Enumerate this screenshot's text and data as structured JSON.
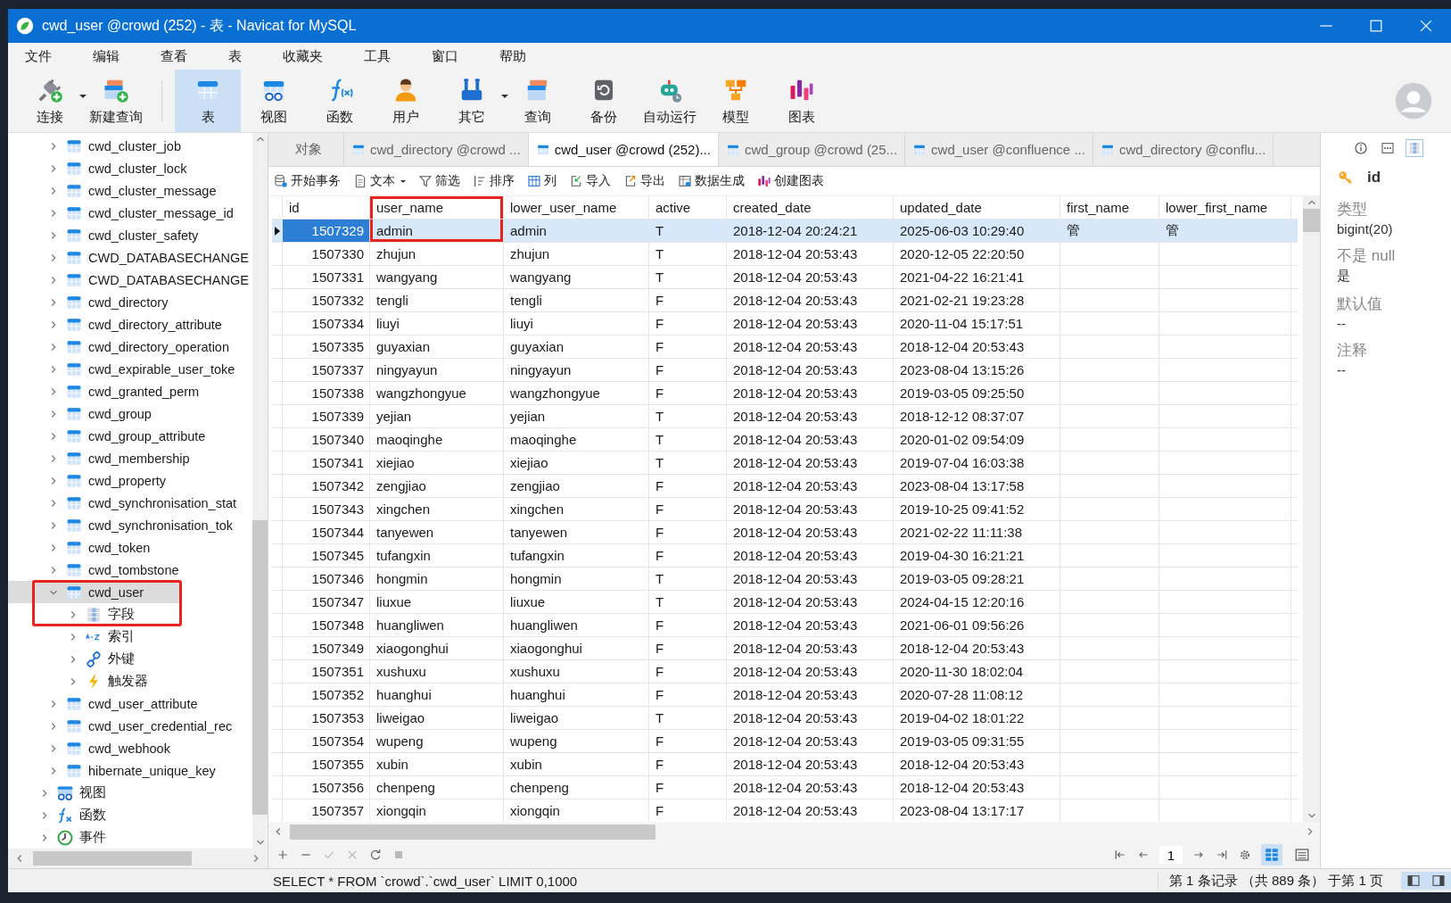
{
  "window": {
    "title": "cwd_user @crowd (252) - 表 - Navicat for MySQL"
  },
  "menu": [
    "文件",
    "编辑",
    "查看",
    "表",
    "收藏夹",
    "工具",
    "窗口",
    "帮助"
  ],
  "toolbar": [
    {
      "kind": "connect",
      "label": "连接",
      "dropdown": true,
      "selected": false
    },
    {
      "kind": "new-query",
      "label": "新建查询",
      "dropdown": false,
      "selected": false
    },
    {
      "kind": "table",
      "label": "表",
      "dropdown": false,
      "selected": true
    },
    {
      "kind": "view",
      "label": "视图",
      "dropdown": false,
      "selected": false
    },
    {
      "kind": "function",
      "label": "函数",
      "dropdown": false,
      "selected": false
    },
    {
      "kind": "user",
      "label": "用户",
      "dropdown": false,
      "selected": false
    },
    {
      "kind": "tools",
      "label": "其它",
      "dropdown": true,
      "selected": false
    },
    {
      "kind": "query",
      "label": "查询",
      "dropdown": false,
      "selected": false
    },
    {
      "kind": "backup",
      "label": "备份",
      "dropdown": false,
      "selected": false
    },
    {
      "kind": "robot",
      "label": "自动运行",
      "dropdown": false,
      "selected": false
    },
    {
      "kind": "model",
      "label": "模型",
      "dropdown": false,
      "selected": false
    },
    {
      "kind": "chart",
      "label": "图表",
      "dropdown": false,
      "selected": false
    }
  ],
  "sidebar": {
    "tables": [
      {
        "label": "cwd_cluster_job",
        "selected": false,
        "expanded": false
      },
      {
        "label": "cwd_cluster_lock",
        "selected": false,
        "expanded": false
      },
      {
        "label": "cwd_cluster_message",
        "selected": false,
        "expanded": false
      },
      {
        "label": "cwd_cluster_message_id",
        "selected": false,
        "expanded": false
      },
      {
        "label": "cwd_cluster_safety",
        "selected": false,
        "expanded": false
      },
      {
        "label": "CWD_DATABASECHANGE",
        "selected": false,
        "expanded": false
      },
      {
        "label": "CWD_DATABASECHANGE",
        "selected": false,
        "expanded": false
      },
      {
        "label": "cwd_directory",
        "selected": false,
        "expanded": false
      },
      {
        "label": "cwd_directory_attribute",
        "selected": false,
        "expanded": false
      },
      {
        "label": "cwd_directory_operation",
        "selected": false,
        "expanded": false
      },
      {
        "label": "cwd_expirable_user_toke",
        "selected": false,
        "expanded": false
      },
      {
        "label": "cwd_granted_perm",
        "selected": false,
        "expanded": false
      },
      {
        "label": "cwd_group",
        "selected": false,
        "expanded": false
      },
      {
        "label": "cwd_group_attribute",
        "selected": false,
        "expanded": false
      },
      {
        "label": "cwd_membership",
        "selected": false,
        "expanded": false
      },
      {
        "label": "cwd_property",
        "selected": false,
        "expanded": false
      },
      {
        "label": "cwd_synchronisation_stat",
        "selected": false,
        "expanded": false
      },
      {
        "label": "cwd_synchronisation_tok",
        "selected": false,
        "expanded": false
      },
      {
        "label": "cwd_token",
        "selected": false,
        "expanded": false
      },
      {
        "label": "cwd_tombstone",
        "selected": false,
        "expanded": false
      },
      {
        "label": "cwd_user",
        "selected": true,
        "expanded": true,
        "annotated": true,
        "children": [
          {
            "kind": "fields",
            "label": "字段",
            "expanded": false
          },
          {
            "kind": "indexes",
            "label": "索引",
            "expanded": false
          },
          {
            "kind": "foreign-keys",
            "label": "外键",
            "expanded": false
          },
          {
            "kind": "triggers",
            "label": "触发器",
            "expanded": false
          }
        ]
      },
      {
        "label": "cwd_user_attribute",
        "selected": false,
        "expanded": false
      },
      {
        "label": "cwd_user_credential_rec",
        "selected": false,
        "expanded": false
      },
      {
        "label": "cwd_webhook",
        "selected": false,
        "expanded": false
      },
      {
        "label": "hibernate_unique_key",
        "selected": false,
        "expanded": false
      }
    ],
    "groups": [
      {
        "kind": "views",
        "label": "视图",
        "expanded": false
      },
      {
        "kind": "functions",
        "label": "函数",
        "expanded": false
      },
      {
        "kind": "events",
        "label": "事件",
        "expanded": false
      }
    ]
  },
  "tabs": [
    {
      "label": "对象",
      "selected": false,
      "kind": "objects"
    },
    {
      "label": "cwd_directory @crowd ...",
      "selected": false,
      "kind": "table"
    },
    {
      "label": "cwd_user @crowd (252)...",
      "selected": true,
      "kind": "table"
    },
    {
      "label": "cwd_group @crowd (25...",
      "selected": false,
      "kind": "table"
    },
    {
      "label": "cwd_user @confluence ...",
      "selected": false,
      "kind": "table"
    },
    {
      "label": "cwd_directory @conflu...",
      "selected": false,
      "kind": "table"
    }
  ],
  "grid_toolbar": [
    {
      "kind": "transaction",
      "label": "开始事务",
      "dropdown": false
    },
    {
      "kind": "text",
      "label": "文本",
      "dropdown": true
    },
    {
      "kind": "filter",
      "label": "筛选",
      "dropdown": false
    },
    {
      "kind": "sort",
      "label": "排序",
      "dropdown": false
    },
    {
      "kind": "columns",
      "label": "列",
      "dropdown": false
    },
    {
      "kind": "import",
      "label": "导入",
      "dropdown": false
    },
    {
      "kind": "export",
      "label": "导出",
      "dropdown": false
    },
    {
      "kind": "generate",
      "label": "数据生成",
      "dropdown": false
    },
    {
      "kind": "chart",
      "label": "创建图表",
      "dropdown": false
    }
  ],
  "table": {
    "columns": [
      {
        "label": "id",
        "annotated": false
      },
      {
        "label": "user_name",
        "annotated": true
      },
      {
        "label": "lower_user_name",
        "annotated": false
      },
      {
        "label": "active",
        "annotated": false
      },
      {
        "label": "created_date",
        "annotated": false
      },
      {
        "label": "updated_date",
        "annotated": false
      },
      {
        "label": "first_name",
        "annotated": false
      },
      {
        "label": "lower_first_name",
        "annotated": false
      }
    ],
    "rows": [
      {
        "selected": true,
        "cells": [
          "1507329",
          "admin",
          "admin",
          "T",
          "2018-12-04 20:24:21",
          "2025-06-03 10:29:40",
          "管",
          "管"
        ]
      },
      {
        "selected": false,
        "cells": [
          "1507330",
          "zhujun",
          "zhujun",
          "T",
          "2018-12-04 20:53:43",
          "2020-12-05 22:20:50"
        ]
      },
      {
        "selected": false,
        "cells": [
          "1507331",
          "wangyang",
          "wangyang",
          "T",
          "2018-12-04 20:53:43",
          "2021-04-22 16:21:41"
        ]
      },
      {
        "selected": false,
        "cells": [
          "1507332",
          "tengli",
          "tengli",
          "F",
          "2018-12-04 20:53:43",
          "2021-02-21 19:23:28"
        ]
      },
      {
        "selected": false,
        "cells": [
          "1507334",
          "liuyi",
          "liuyi",
          "F",
          "2018-12-04 20:53:43",
          "2020-11-04 15:17:51"
        ]
      },
      {
        "selected": false,
        "cells": [
          "1507335",
          "guyaxian",
          "guyaxian",
          "F",
          "2018-12-04 20:53:43",
          "2018-12-04 20:53:43"
        ]
      },
      {
        "selected": false,
        "cells": [
          "1507337",
          "ningyayun",
          "ningyayun",
          "F",
          "2018-12-04 20:53:43",
          "2023-08-04 13:15:26"
        ]
      },
      {
        "selected": false,
        "cells": [
          "1507338",
          "wangzhongyue",
          "wangzhongyue",
          "F",
          "2018-12-04 20:53:43",
          "2019-03-05 09:25:50"
        ]
      },
      {
        "selected": false,
        "cells": [
          "1507339",
          "yejian",
          "yejian",
          "T",
          "2018-12-04 20:53:43",
          "2018-12-12 08:37:07"
        ]
      },
      {
        "selected": false,
        "cells": [
          "1507340",
          "maoqinghe",
          "maoqinghe",
          "T",
          "2018-12-04 20:53:43",
          "2020-01-02 09:54:09"
        ]
      },
      {
        "selected": false,
        "cells": [
          "1507341",
          "xiejiao",
          "xiejiao",
          "T",
          "2018-12-04 20:53:43",
          "2019-07-04 16:03:38"
        ]
      },
      {
        "selected": false,
        "cells": [
          "1507342",
          "zengjiao",
          "zengjiao",
          "F",
          "2018-12-04 20:53:43",
          "2023-08-04 13:17:58"
        ]
      },
      {
        "selected": false,
        "cells": [
          "1507343",
          "xingchen",
          "xingchen",
          "F",
          "2018-12-04 20:53:43",
          "2019-10-25 09:41:52"
        ]
      },
      {
        "selected": false,
        "cells": [
          "1507344",
          "tanyewen",
          "tanyewen",
          "F",
          "2018-12-04 20:53:43",
          "2021-02-22 11:11:38"
        ]
      },
      {
        "selected": false,
        "cells": [
          "1507345",
          "tufangxin",
          "tufangxin",
          "F",
          "2018-12-04 20:53:43",
          "2019-04-30 16:21:21"
        ]
      },
      {
        "selected": false,
        "cells": [
          "1507346",
          "hongmin",
          "hongmin",
          "T",
          "2018-12-04 20:53:43",
          "2019-03-05 09:28:21"
        ]
      },
      {
        "selected": false,
        "cells": [
          "1507347",
          "liuxue",
          "liuxue",
          "T",
          "2018-12-04 20:53:43",
          "2024-04-15 12:20:16"
        ]
      },
      {
        "selected": false,
        "cells": [
          "1507348",
          "huangliwen",
          "huangliwen",
          "F",
          "2018-12-04 20:53:43",
          "2021-06-01 09:56:26"
        ]
      },
      {
        "selected": false,
        "cells": [
          "1507349",
          "xiaogonghui",
          "xiaogonghui",
          "F",
          "2018-12-04 20:53:43",
          "2018-12-04 20:53:43"
        ]
      },
      {
        "selected": false,
        "cells": [
          "1507351",
          "xushuxu",
          "xushuxu",
          "F",
          "2018-12-04 20:53:43",
          "2020-11-30 18:02:04"
        ]
      },
      {
        "selected": false,
        "cells": [
          "1507352",
          "huanghui",
          "huanghui",
          "F",
          "2018-12-04 20:53:43",
          "2020-07-28 11:08:12"
        ]
      },
      {
        "selected": false,
        "cells": [
          "1507353",
          "liweigao",
          "liweigao",
          "T",
          "2018-12-04 20:53:43",
          "2019-04-02 18:01:22"
        ]
      },
      {
        "selected": false,
        "cells": [
          "1507354",
          "wupeng",
          "wupeng",
          "F",
          "2018-12-04 20:53:43",
          "2019-03-05 09:31:55"
        ]
      },
      {
        "selected": false,
        "cells": [
          "1507355",
          "xubin",
          "xubin",
          "F",
          "2018-12-04 20:53:43",
          "2018-12-04 20:53:43"
        ]
      },
      {
        "selected": false,
        "cells": [
          "1507356",
          "chenpeng",
          "chenpeng",
          "F",
          "2018-12-04 20:53:43",
          "2018-12-04 20:53:43"
        ]
      },
      {
        "selected": false,
        "cells": [
          "1507357",
          "xiongqin",
          "xiongqin",
          "F",
          "2018-12-04 20:53:43",
          "2023-08-04 13:17:17"
        ]
      }
    ]
  },
  "pager": {
    "page": "1"
  },
  "view_modes": [
    {
      "kind": "grid",
      "selected": true
    },
    {
      "kind": "form",
      "selected": false
    }
  ],
  "inspector": {
    "modes": [
      {
        "kind": "info",
        "selected": false
      },
      {
        "kind": "ddl",
        "selected": false
      },
      {
        "kind": "fields",
        "selected": true
      }
    ],
    "field": "id",
    "properties": [
      {
        "label": "类型",
        "value": "bigint(20)"
      },
      {
        "label": "不是 null",
        "value": "是"
      },
      {
        "label": "默认值",
        "value": "--"
      },
      {
        "label": "注释",
        "value": "--"
      }
    ]
  },
  "status_bar": {
    "sql": "SELECT * FROM `crowd`.`cwd_user` LIMIT 0,1000",
    "records": "第 1 条记录 （共 889 条） 于第 1 页",
    "panels": [
      {
        "kind": "left",
        "selected": true
      },
      {
        "kind": "right",
        "selected": true
      }
    ]
  }
}
